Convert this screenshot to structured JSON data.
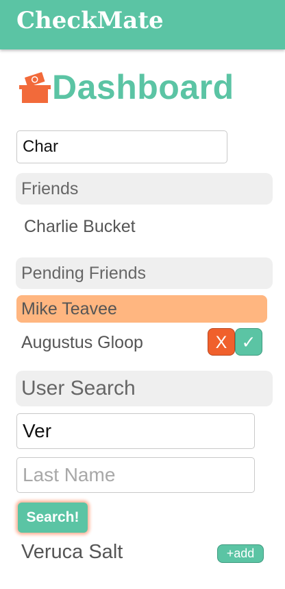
{
  "app": {
    "brand": "CheckMate"
  },
  "dashboard": {
    "title": "Dashboard",
    "icon": "box-with-money-icon"
  },
  "friend_filter": {
    "value": "Char"
  },
  "friends": {
    "header": "Friends",
    "items": [
      "Charlie Bucket"
    ]
  },
  "pending": {
    "header": "Pending Friends",
    "items": [
      {
        "name": "Mike Teavee",
        "highlighted": true
      },
      {
        "name": "Augustus Gloop",
        "reject_label": "X",
        "accept_label": "✓"
      }
    ]
  },
  "user_search": {
    "header": "User Search",
    "first_name_value": "Ver",
    "last_name_placeholder": "Last Name",
    "search_label": "Search!",
    "results": [
      {
        "name": "Veruca Salt",
        "add_label": "+add"
      }
    ]
  },
  "colors": {
    "accent": "#5bc4a4",
    "highlight": "#ffb680",
    "reject": "#f0602c",
    "section_bg": "#efefef"
  }
}
